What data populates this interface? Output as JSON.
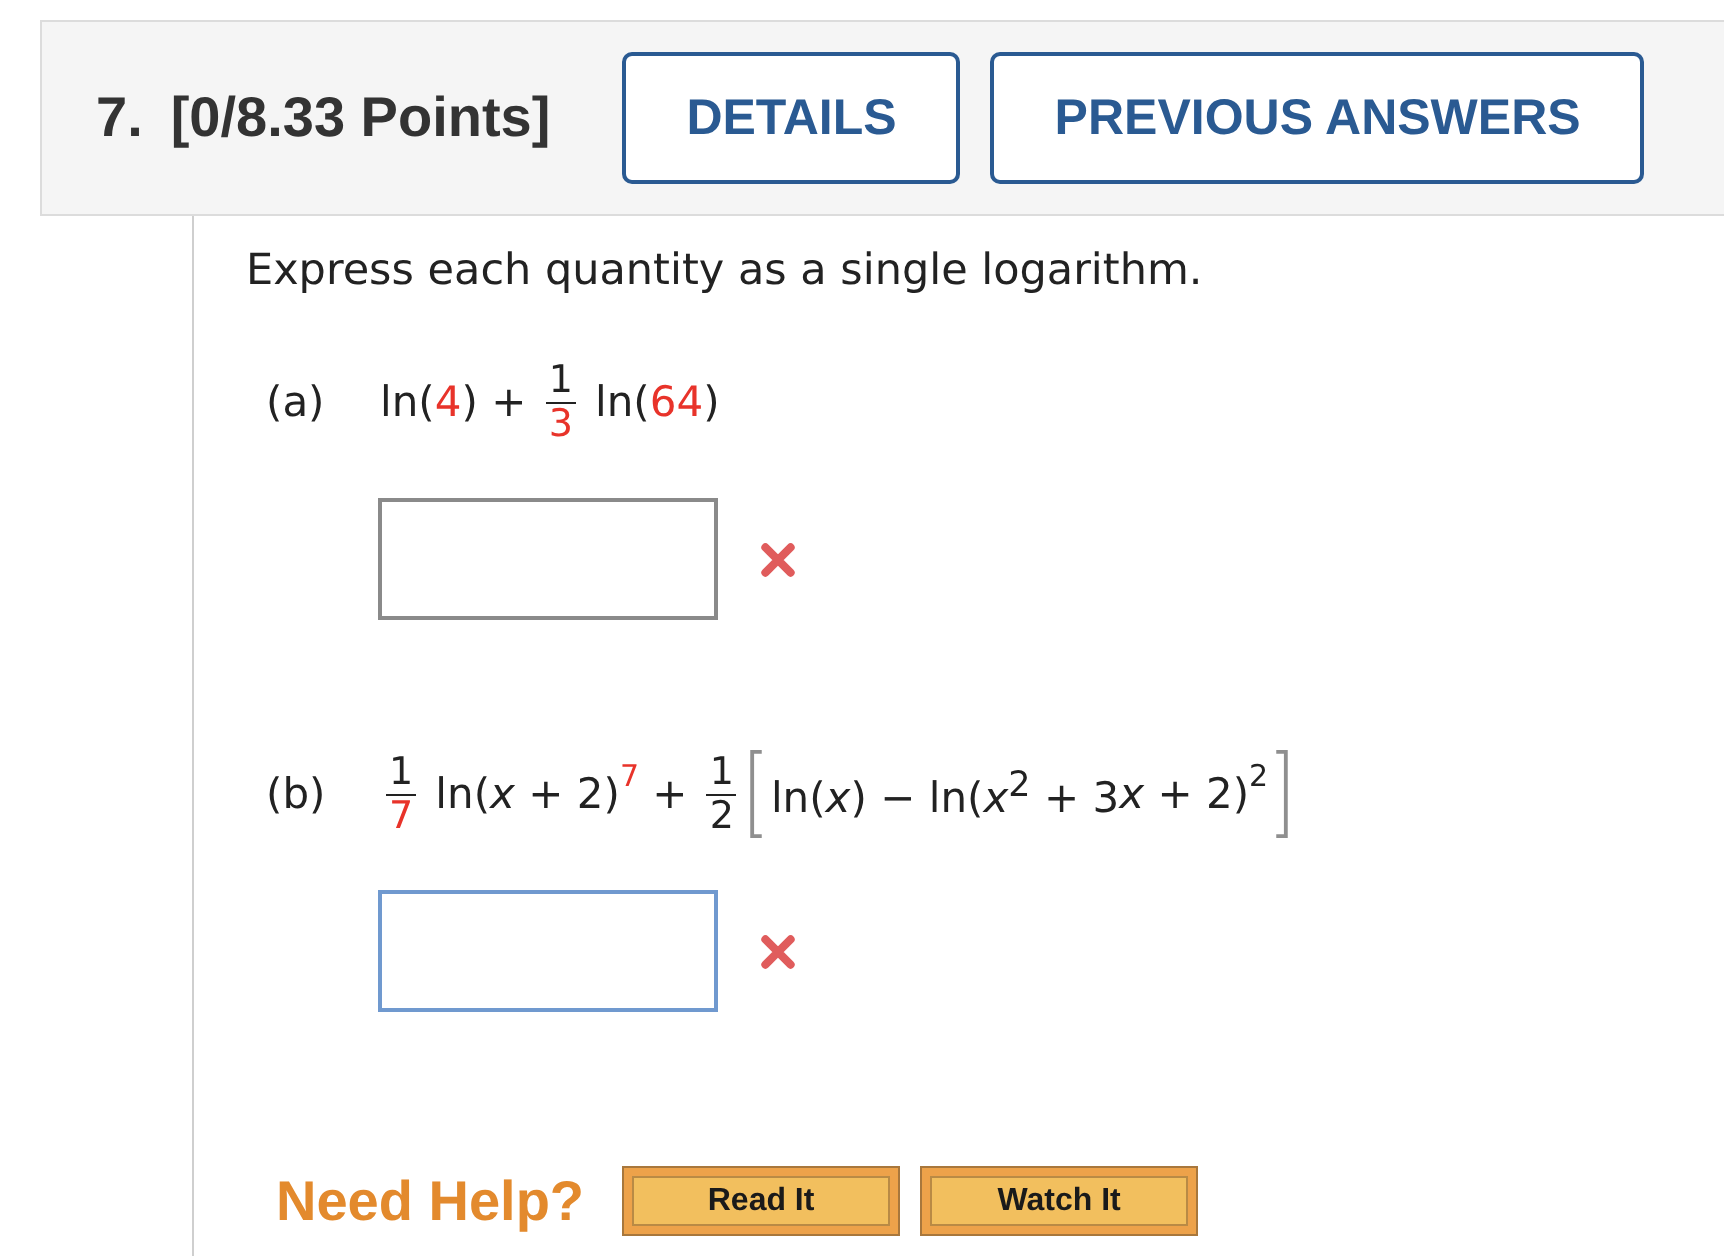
{
  "question": {
    "number": "7.",
    "points": "[0/8.33 Points]",
    "buttons": [
      {
        "label": "DETAILS"
      },
      {
        "label": "PREVIOUS ANSWERS"
      }
    ]
  },
  "instruction": "Express each quantity as a single logarithm.",
  "parts": [
    {
      "label": "(a)",
      "expression": [
        {
          "kind": "text",
          "text": "ln(",
          "highlighted": false
        },
        {
          "kind": "text",
          "text": "4",
          "highlighted": true
        },
        {
          "kind": "text",
          "text": ") + ",
          "highlighted": false
        },
        {
          "kind": "frac",
          "numerator": {
            "text": "1",
            "highlighted": false
          },
          "denominator": {
            "text": "3",
            "highlighted": true
          }
        },
        {
          "kind": "text",
          "text": " ln(",
          "highlighted": false
        },
        {
          "kind": "text",
          "text": "64",
          "highlighted": true
        },
        {
          "kind": "text",
          "text": ")",
          "highlighted": false
        }
      ],
      "answer": {
        "focused": false,
        "correct": false
      }
    },
    {
      "label": "(b)",
      "expression": [
        {
          "kind": "frac",
          "numerator": {
            "text": "1",
            "highlighted": false
          },
          "denominator": {
            "text": "7",
            "highlighted": true
          }
        },
        {
          "kind": "text",
          "text": " ln(*x* + 2)",
          "highlighted": false
        },
        {
          "kind": "sup",
          "text": "7",
          "highlighted": true
        },
        {
          "kind": "text",
          "text": " + ",
          "highlighted": false
        },
        {
          "kind": "frac",
          "numerator": {
            "text": "1",
            "highlighted": false
          },
          "denominator": {
            "text": "2",
            "highlighted": false
          }
        },
        {
          "kind": "bracket",
          "children": [
            {
              "kind": "text",
              "text": "ln(*x*) − ln(*x*$^{2}$ + 3",
              "highlighted": false
            },
            {
              "kind": "text",
              "text": "*x* + 2)",
              "highlighted": false
            },
            {
              "kind": "sup",
              "text": "2",
              "highlighted": false
            }
          ]
        }
      ],
      "answer": {
        "focused": true,
        "correct": false
      }
    }
  ],
  "help": {
    "label": "Need Help?",
    "buttons": [
      {
        "label": "Read It"
      },
      {
        "label": "Watch It"
      }
    ]
  }
}
